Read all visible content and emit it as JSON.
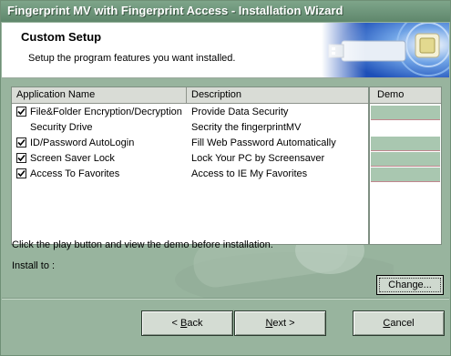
{
  "window": {
    "title": "Fingerprint MV with Fingerprint Access - Installation Wizard"
  },
  "header": {
    "title": "Custom Setup",
    "subtitle": "Setup the program features you want installed."
  },
  "features": {
    "columns": {
      "name": "Application Name",
      "description": "Description",
      "demo": "Demo"
    },
    "rows": [
      {
        "name": "File&Folder Encryption/Decryption",
        "description": "Provide Data Security",
        "checked": true,
        "has_checkbox": true,
        "has_demo": true
      },
      {
        "name": "Security Drive",
        "description": "Secrity the fingerprintMV",
        "checked": false,
        "has_checkbox": false,
        "has_demo": false
      },
      {
        "name": "ID/Password AutoLogin",
        "description": "Fill Web Password Automatically",
        "checked": true,
        "has_checkbox": true,
        "has_demo": true
      },
      {
        "name": "Screen Saver Lock",
        "description": "Lock Your PC by Screensaver",
        "checked": true,
        "has_checkbox": true,
        "has_demo": true
      },
      {
        "name": "Access To Favorites",
        "description": "Access to IE My Favorites",
        "checked": true,
        "has_checkbox": true,
        "has_demo": true
      }
    ]
  },
  "hint": "Click the play button and view the demo before installation.",
  "install_to_label": "Install to :",
  "buttons": {
    "change": {
      "label": "Change..."
    },
    "back": {
      "prefix": "< ",
      "mnemonic": "B",
      "rest": "ack"
    },
    "next": {
      "mnemonic": "N",
      "rest": "ext >"
    },
    "cancel": {
      "mnemonic": "C",
      "rest": "ancel"
    }
  },
  "colors": {
    "accent": "#98b49e",
    "demo_cell": "#a9c7b0"
  }
}
